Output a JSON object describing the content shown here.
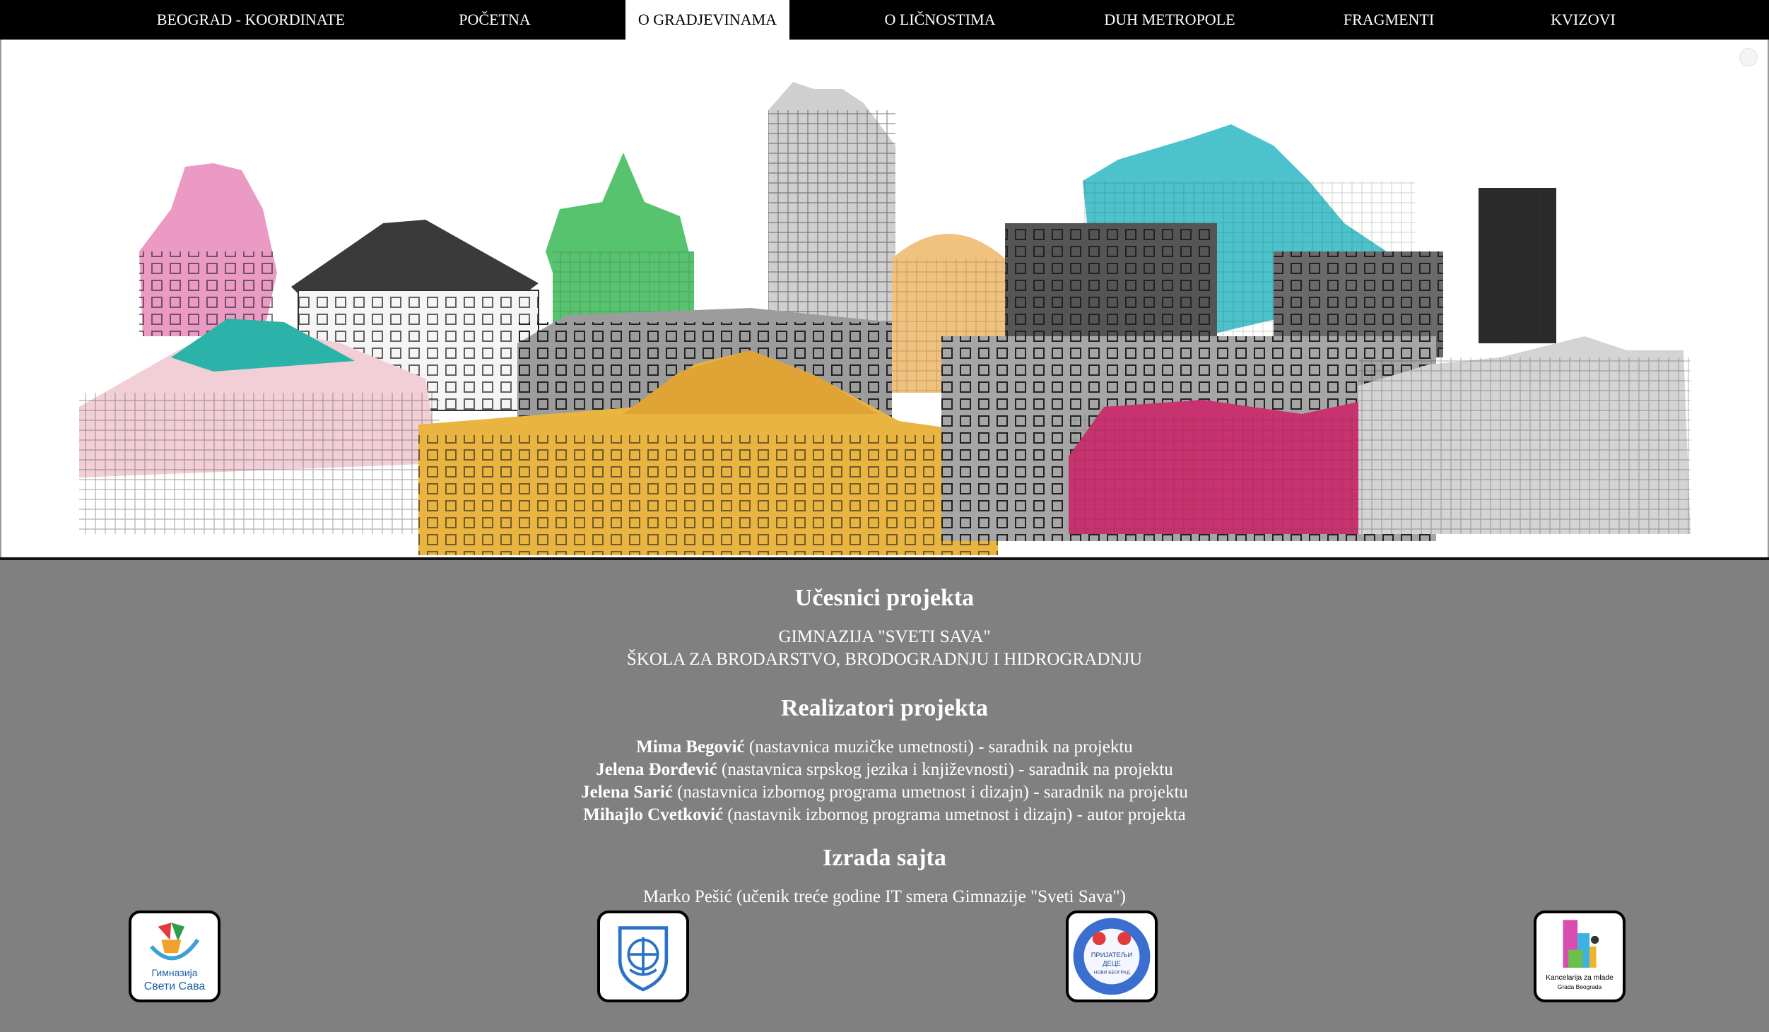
{
  "nav": {
    "items": [
      {
        "label": "BEOGRAD - KOORDINATE",
        "active": false
      },
      {
        "label": "POČETNA",
        "active": false
      },
      {
        "label": "O GRADJEVINAMA",
        "active": true
      },
      {
        "label": "O LIČNOSTIMA",
        "active": false
      },
      {
        "label": "DUH METROPOLE",
        "active": false
      },
      {
        "label": "FRAGMENTI",
        "active": false
      },
      {
        "label": "KVIZOVI",
        "active": false
      }
    ]
  },
  "banner": {
    "expand_icon": "expand-icon"
  },
  "participants": {
    "heading": "Učesnici projekta",
    "schools": [
      "GIMNAZIJA \"SVETI SAVA\"",
      "ŠKOLA ZA BRODARSTVO, BRODOGRADNJU I HIDROGRADNJU"
    ]
  },
  "realizers": {
    "heading": "Realizatori projekta",
    "people": [
      {
        "name": "Mima Begović",
        "role": " (nastavnica muzičke umetnosti) - saradnik na projektu"
      },
      {
        "name": "Jelena Đorđević",
        "role": " (nastavnica srpskog jezika i književnosti) - saradnik na projektu"
      },
      {
        "name": "Jelena Sarić",
        "role": " (nastavnica izbornog programa umetnost i dizajn) - saradnik na projektu"
      },
      {
        "name": "Mihajlo Cvetković",
        "role": " (nastavnik izbornog programa umetnost i dizajn) - autor projekta"
      }
    ]
  },
  "site": {
    "heading": "Izrada sajta",
    "author": "Marko Pešić (učenik treće godine IT smera Gimnazije \"Sveti Sava\")"
  },
  "logos": [
    {
      "name": "gimnazija-sveti-sava-logo",
      "text_line1": "Гимназија",
      "text_line2": "Свети Сава"
    },
    {
      "name": "skola-za-brodarstvo-logo"
    },
    {
      "name": "prijatelji-dece-logo",
      "text_line1": "ПРИЈАТЕЉИ",
      "text_line2": "ДЕЦЕ",
      "text_line3": "НОВИ БЕОГРАД"
    },
    {
      "name": "kancelarija-za-mlade-logo",
      "text_line1": "Kancelarija za mlade",
      "text_line2": "Grada Beograda"
    }
  ],
  "colors": {
    "nav_bg": "#000000",
    "page_bg": "#808080",
    "pink": "#e07fb0",
    "green": "#4dbb6a",
    "cyan": "#4cc3cc",
    "yellow": "#e9b43f",
    "magenta": "#c8336f",
    "gray_building": "#8d8d8d"
  }
}
